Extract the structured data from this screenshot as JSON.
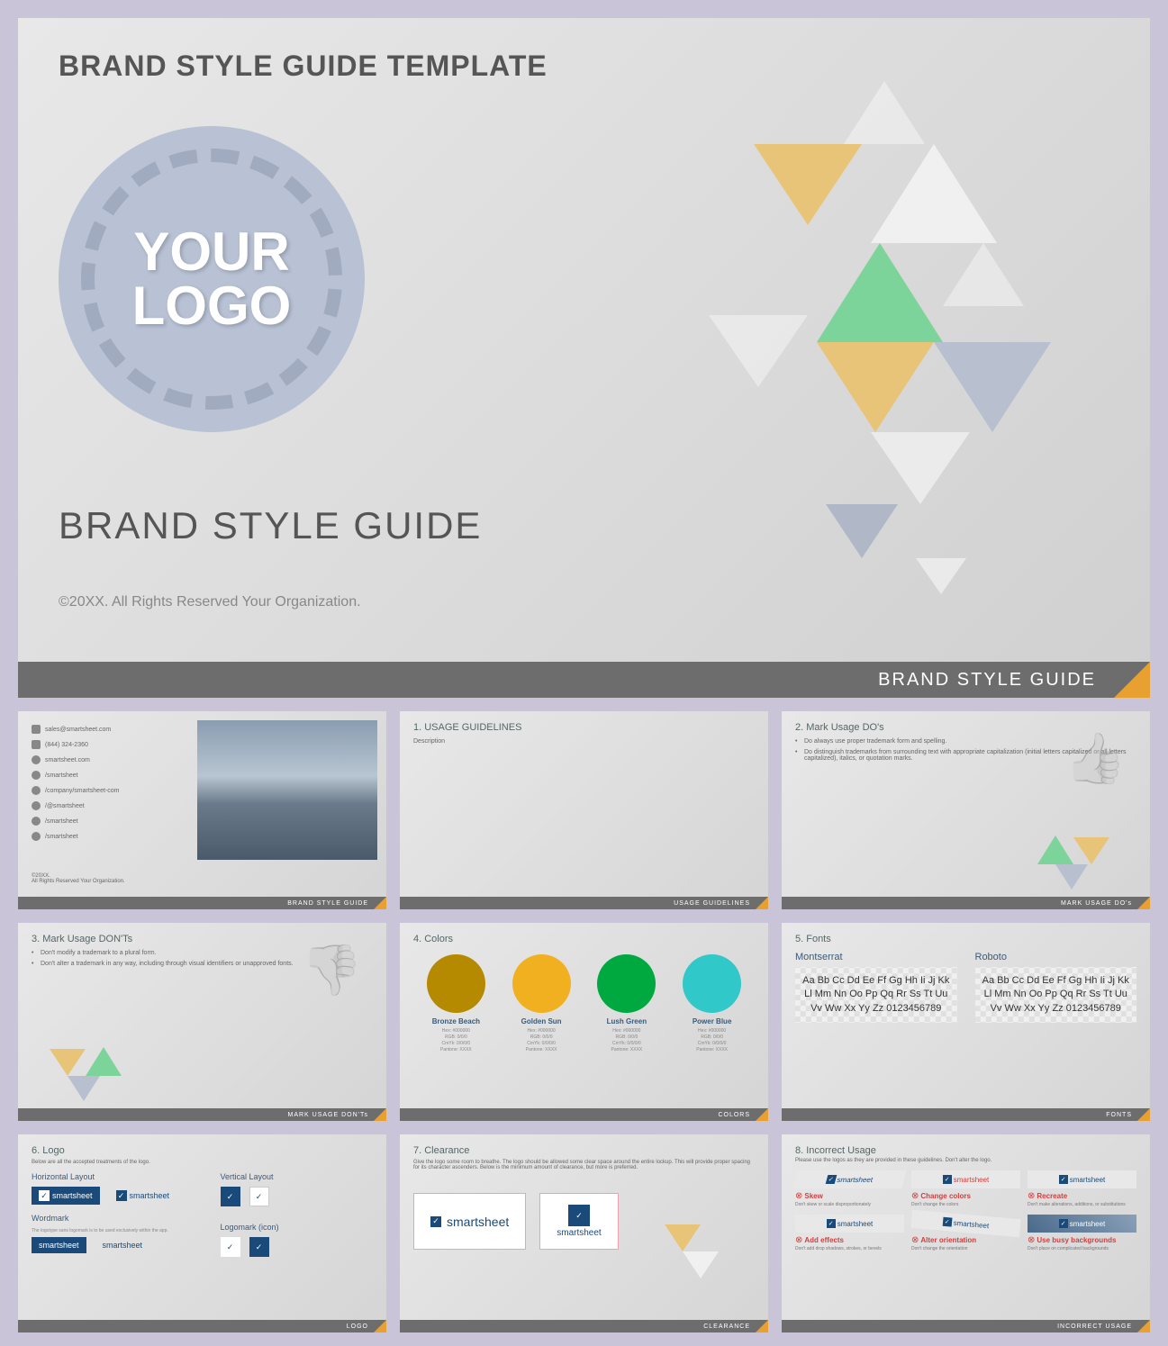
{
  "main": {
    "title": "BRAND STYLE GUIDE TEMPLATE",
    "logo_line1": "YOUR",
    "logo_line2": "LOGO",
    "subtitle": "BRAND STYLE GUIDE",
    "copyright": "©20XX. All Rights Reserved Your Organization.",
    "footer": "BRAND STYLE GUIDE"
  },
  "slides": {
    "contact": {
      "email": "sales@smartsheet.com",
      "phone": "(844) 324-2360",
      "web": "smartsheet.com",
      "fb": "/smartsheet",
      "li": "/company/smartsheet-com",
      "ig": "/@smartsheet",
      "tw": "/smartsheet",
      "yt": "/smartsheet",
      "copy1": "©20XX.",
      "copy2": "All Rights Reserved Your Organization.",
      "footer": "BRAND STYLE GUIDE"
    },
    "usage": {
      "title": "1. USAGE GUIDELINES",
      "desc": "Description",
      "footer": "USAGE GUIDELINES"
    },
    "dos": {
      "title": "2. Mark Usage DO's",
      "b1": "Do always use proper trademark form and spelling.",
      "b2": "Do distinguish trademarks from surrounding text with appropriate capitalization (initial letters capitalized or all letters capitalized), italics, or quotation marks.",
      "footer": "MARK USAGE DO's"
    },
    "donts": {
      "title": "3. Mark Usage DON'Ts",
      "b1": "Don't modify a trademark to a plural form.",
      "b2": "Don't alter a trademark in any way, including through visual identifiers or unapproved fonts.",
      "footer": "MARK USAGE DON'Ts"
    },
    "colors": {
      "title": "4. Colors",
      "footer": "COLORS",
      "items": [
        {
          "name": "Bronze Beach",
          "hex": "#b58a00",
          "meta": "Hex: #000000\nRGB: 0/0/0\nCmYk: 0/0/0/0\nPantone: XXXX"
        },
        {
          "name": "Golden Sun",
          "hex": "#f0b020",
          "meta": "Hex: #000000\nRGB: 0/0/0\nCmYk: 0/0/0/0\nPantone: XXXX"
        },
        {
          "name": "Lush Green",
          "hex": "#00a840",
          "meta": "Hex: #000000\nRGB: 0/0/0\nCmYk: 0/0/0/0\nPantone: XXXX"
        },
        {
          "name": "Power Blue",
          "hex": "#30c8c8",
          "meta": "Hex: #000000\nRGB: 0/0/0\nCmYk: 0/0/0/0\nPantone: XXXX"
        }
      ]
    },
    "fonts": {
      "title": "5. Fonts",
      "footer": "FONTS",
      "f1": "Montserrat",
      "f2": "Roboto",
      "sample": "Aa Bb Cc Dd Ee Ff Gg Hh Ii Jj Kk Ll Mm Nn Oo Pp Qq Rr Ss Tt Uu Vv Ww Xx Yy Zz 0123456789"
    },
    "logo": {
      "title": "6. Logo",
      "desc": "Below are all the accepted treatments of the logo.",
      "h1": "Horizontal Layout",
      "h2": "Vertical Layout",
      "h3": "Wordmark",
      "h3d": "The logotype sans logomark is to be used exclusively within the app.",
      "h4": "Logomark (icon)",
      "brand": "smartsheet",
      "footer": "LOGO"
    },
    "clearance": {
      "title": "7. Clearance",
      "desc": "Give the logo some room to breathe. The logo should be allowed some clear space around the entire lockup. This will provide proper spacing for its character ascenders. Below is the minimum amount of clearance, but more is preferred.",
      "brand": "smartsheet",
      "footer": "CLEARANCE"
    },
    "incorrect": {
      "title": "8. Incorrect Usage",
      "desc": "Please use the logos as they are provided in these guidelines. Don't alter the logo.",
      "brand": "smartsheet",
      "items": [
        {
          "t": "Skew",
          "d": "Don't skew or scale disproportionately"
        },
        {
          "t": "Change colors",
          "d": "Don't change the colors"
        },
        {
          "t": "Recreate",
          "d": "Don't make alterations, additions, or substitutions"
        },
        {
          "t": "Add effects",
          "d": "Don't add drop shadows, strokes, or bevels"
        },
        {
          "t": "Alter orientation",
          "d": "Don't change the orientation"
        },
        {
          "t": "Use busy backgrounds",
          "d": "Don't place on complicated backgrounds"
        }
      ],
      "footer": "INCORRECT USAGE"
    }
  }
}
